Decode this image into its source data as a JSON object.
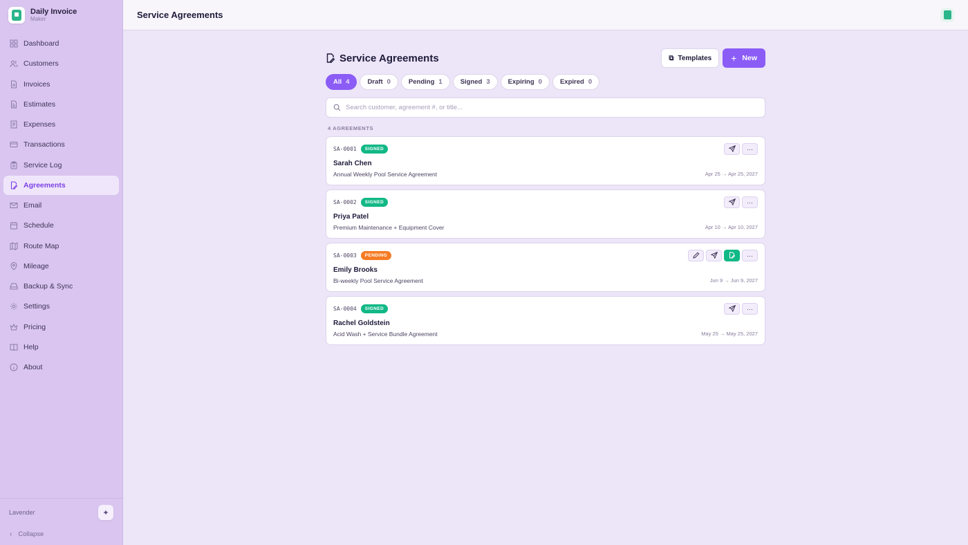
{
  "brand": {
    "name": "Daily Invoice",
    "sub": "Maker"
  },
  "sidebar": {
    "items": [
      {
        "label": "Dashboard",
        "icon": "grid-icon"
      },
      {
        "label": "Customers",
        "icon": "users-icon"
      },
      {
        "label": "Invoices",
        "icon": "file-icon"
      },
      {
        "label": "Estimates",
        "icon": "file-text-icon"
      },
      {
        "label": "Expenses",
        "icon": "receipt-icon"
      },
      {
        "label": "Transactions",
        "icon": "credit-card-icon"
      },
      {
        "label": "Service Log",
        "icon": "clipboard-icon"
      },
      {
        "label": "Agreements",
        "icon": "file-signature-icon",
        "active": true
      },
      {
        "label": "Email",
        "icon": "mail-icon"
      },
      {
        "label": "Schedule",
        "icon": "calendar-icon"
      },
      {
        "label": "Route Map",
        "icon": "map-icon"
      },
      {
        "label": "Mileage",
        "icon": "map-pin-icon"
      },
      {
        "label": "Backup & Sync",
        "icon": "hard-drive-icon"
      },
      {
        "label": "Settings",
        "icon": "gear-icon"
      },
      {
        "label": "Pricing",
        "icon": "crown-icon"
      },
      {
        "label": "Help",
        "icon": "book-icon"
      },
      {
        "label": "About",
        "icon": "info-icon"
      }
    ],
    "theme_label": "Lavender",
    "collapse_label": "Collapse"
  },
  "topbar": {
    "title": "Service Agreements"
  },
  "main": {
    "title": "Service Agreements",
    "templates_label": "Templates",
    "new_label": "New",
    "filters": [
      {
        "label": "All",
        "count": "4",
        "active": true
      },
      {
        "label": "Draft",
        "count": "0"
      },
      {
        "label": "Pending",
        "count": "1"
      },
      {
        "label": "Signed",
        "count": "3"
      },
      {
        "label": "Expiring",
        "count": "0"
      },
      {
        "label": "Expired",
        "count": "0"
      }
    ],
    "search_placeholder": "Search customer, agreement #, or title...",
    "count_label": "4 AGREEMENTS",
    "agreements": [
      {
        "number": "SA-0001",
        "status": "SIGNED",
        "name": "Sarah Chen",
        "title": "Annual Weekly Pool Service Agreement",
        "dates": "Apr 25 → Apr 25, 2027"
      },
      {
        "number": "SA-0002",
        "status": "SIGNED",
        "name": "Priya Patel",
        "title": "Premium Maintenance + Equipment Cover",
        "dates": "Apr 10 → Apr 10, 2027"
      },
      {
        "number": "SA-0003",
        "status": "PENDING",
        "name": "Emily Brooks",
        "title": "Bi-weekly Pool Service Agreement",
        "dates": "Jun 9 → Jun 9, 2027"
      },
      {
        "number": "SA-0004",
        "status": "SIGNED",
        "name": "Rachel Goldstein",
        "title": "Acid Wash + Service Bundle Agreement",
        "dates": "May 25 → May 25, 2027"
      }
    ]
  },
  "colors": {
    "accent": "#8b5cf6",
    "signed": "#12b886",
    "pending": "#f57c25",
    "sidebar_bg": "#d9c5ef",
    "page_bg": "#ede5f8"
  }
}
